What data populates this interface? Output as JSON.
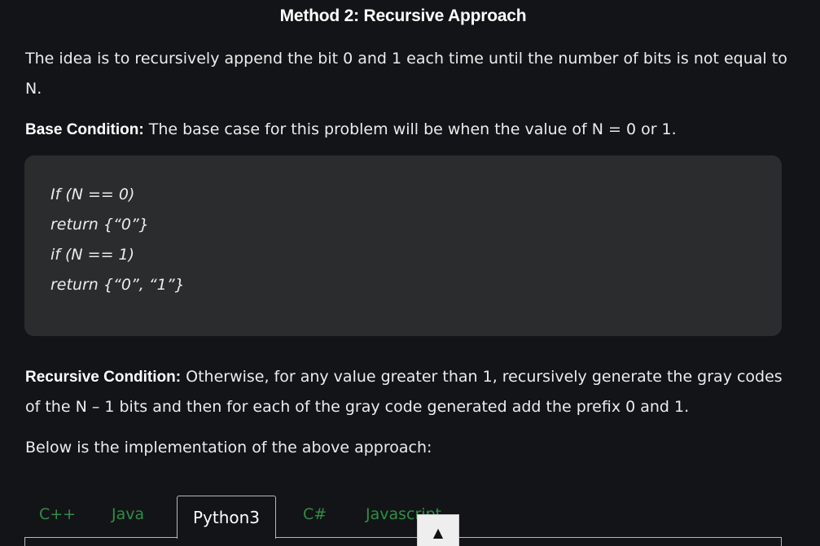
{
  "article": {
    "heading": "Method 2: Recursive Approach",
    "idea": "The idea is to recursively append the bit 0 and 1 each time until the number of bits is not equal to N.",
    "base_label": "Base Condition:",
    "base_text": " The base case for this problem will be when the value of N = 0 or 1.",
    "code_lines": [
      "If (N == 0)",
      "return {“0”}",
      "if (N == 1)",
      "return {“0”, “1”}"
    ],
    "recursive_label": "Recursive Condition:",
    "recursive_text": " Otherwise, for any value greater than 1, recursively generate the gray codes of the N – 1 bits and then for each of the gray code generated add the prefix 0 and 1.",
    "implementation_intro": "Below is the implementation of the above approach:"
  },
  "tabs": {
    "items": [
      "C++",
      "Java",
      "Python3",
      "C#",
      "Javascript"
    ],
    "active": "Python3"
  },
  "scroll_to_top": {
    "icon": "arrow-up-icon",
    "glyph": "▲"
  },
  "colors": {
    "background": "#131417",
    "tab_text": "#2f8d46",
    "code_block": "#2b2c2e"
  }
}
